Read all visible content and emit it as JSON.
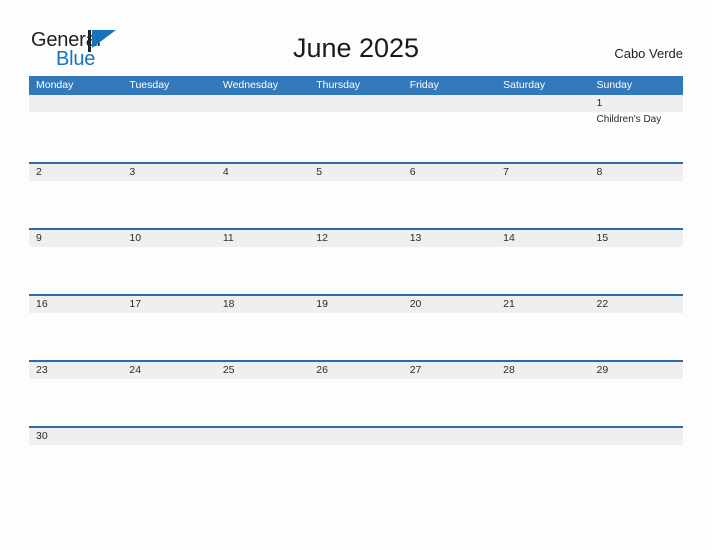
{
  "brand": {
    "word_one": "General",
    "word_two": "Blue",
    "mark": "flag-triangle-icon",
    "color_dark": "#231f20",
    "color_blue": "#1673be"
  },
  "header": {
    "title": "June 2025",
    "region": "Cabo Verde"
  },
  "theme": {
    "header_blue": "#3478bc",
    "row_rule_blue": "#2a6ca8",
    "day_band_gray": "#efefef",
    "page_background": "#fdfdfd"
  },
  "calendar": {
    "weekday_headers": [
      "Monday",
      "Tuesday",
      "Wednesday",
      "Thursday",
      "Friday",
      "Saturday",
      "Sunday"
    ],
    "weeks": [
      [
        {
          "day": ""
        },
        {
          "day": ""
        },
        {
          "day": ""
        },
        {
          "day": ""
        },
        {
          "day": ""
        },
        {
          "day": ""
        },
        {
          "day": "1",
          "events": [
            "Children's Day"
          ]
        }
      ],
      [
        {
          "day": "2"
        },
        {
          "day": "3"
        },
        {
          "day": "4"
        },
        {
          "day": "5"
        },
        {
          "day": "6"
        },
        {
          "day": "7"
        },
        {
          "day": "8"
        }
      ],
      [
        {
          "day": "9"
        },
        {
          "day": "10"
        },
        {
          "day": "11"
        },
        {
          "day": "12"
        },
        {
          "day": "13"
        },
        {
          "day": "14"
        },
        {
          "day": "15"
        }
      ],
      [
        {
          "day": "16"
        },
        {
          "day": "17"
        },
        {
          "day": "18"
        },
        {
          "day": "19"
        },
        {
          "day": "20"
        },
        {
          "day": "21"
        },
        {
          "day": "22"
        }
      ],
      [
        {
          "day": "23"
        },
        {
          "day": "24"
        },
        {
          "day": "25"
        },
        {
          "day": "26"
        },
        {
          "day": "27"
        },
        {
          "day": "28"
        },
        {
          "day": "29"
        }
      ],
      [
        {
          "day": "30"
        },
        {
          "day": ""
        },
        {
          "day": ""
        },
        {
          "day": ""
        },
        {
          "day": ""
        },
        {
          "day": ""
        },
        {
          "day": ""
        }
      ]
    ]
  }
}
